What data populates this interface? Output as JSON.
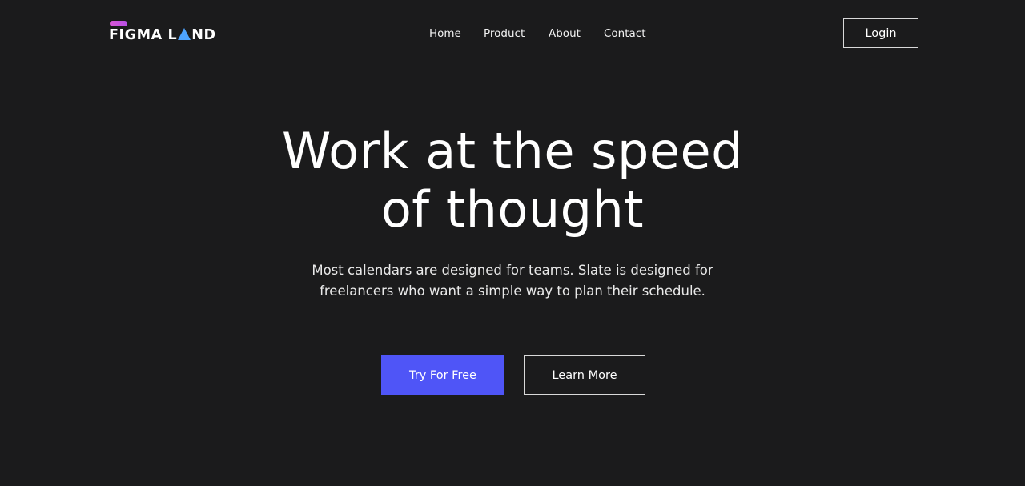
{
  "brand": {
    "name_part1": "FIGMA L",
    "name_part2": "ND",
    "accent_colors": {
      "bar": "#d957d6",
      "triangle": "#4da3ff"
    }
  },
  "nav": {
    "items": [
      {
        "label": "Home"
      },
      {
        "label": "Product"
      },
      {
        "label": "About"
      },
      {
        "label": "Contact"
      }
    ],
    "login_label": "Login"
  },
  "hero": {
    "title_line1": "Work at the speed",
    "title_line2": "of thought",
    "subtitle_line1": "Most calendars are designed for teams. Slate is designed for",
    "subtitle_line2": "freelancers who want a simple way to plan their schedule.",
    "primary_cta": "Try For Free",
    "secondary_cta": "Learn More"
  },
  "colors": {
    "background": "#1b1b1c",
    "primary_button": "#4f55f7",
    "text": "#ffffff"
  }
}
